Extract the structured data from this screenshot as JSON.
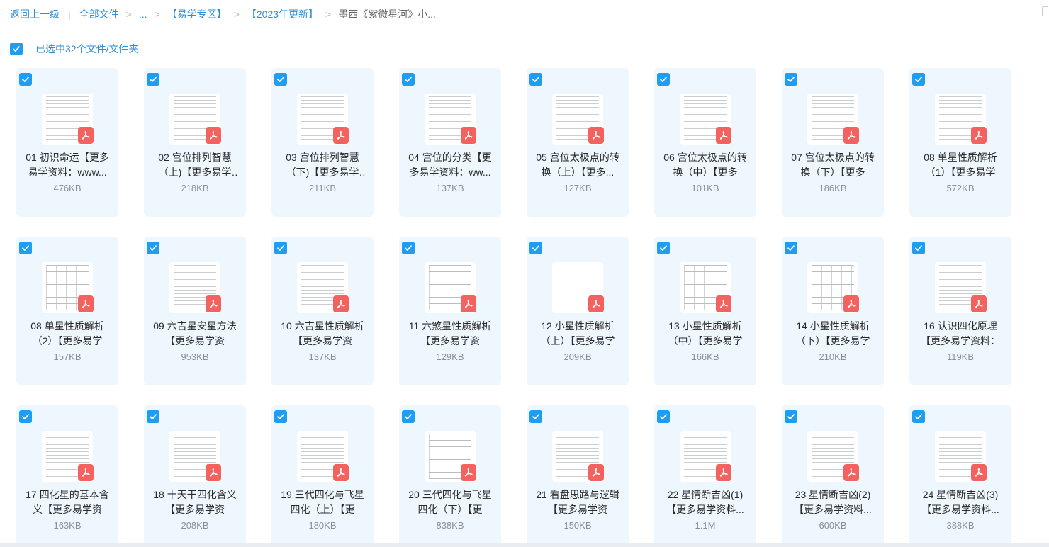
{
  "breadcrumb": {
    "back": "返回上一级",
    "all_files": "全部文件",
    "ellipsis": "...",
    "level1": "【易学专区】",
    "level2": "【2023年更新】",
    "current": "墨西《紫微星河》小..."
  },
  "selection": {
    "label": "已选中32个文件/文件夹"
  },
  "files": [
    {
      "name": "01 初识命运【更多易学资料：www...",
      "size": "476KB",
      "thumb": "lines"
    },
    {
      "name": "02 宫位排列智慧（上)【更多易学资...",
      "size": "218KB",
      "thumb": "lines"
    },
    {
      "name": "03 宫位排列智慧（下)【更多易学资...",
      "size": "211KB",
      "thumb": "lines"
    },
    {
      "name": "04 宫位的分类【更多易学资料：ww...",
      "size": "137KB",
      "thumb": "lines"
    },
    {
      "name": "05 宫位太极点的转换（上）【更多...",
      "size": "127KB",
      "thumb": "lines"
    },
    {
      "name": "06 宫位太极点的转换（中）【更多",
      "size": "101KB",
      "thumb": "lines"
    },
    {
      "name": "07 宫位太极点的转换（下）【更多",
      "size": "186KB",
      "thumb": "lines"
    },
    {
      "name": "08 单星性质解析（1）【更多易学",
      "size": "572KB",
      "thumb": "lines"
    },
    {
      "name": "08 单星性质解析（2）【更多易学",
      "size": "157KB",
      "thumb": "table"
    },
    {
      "name": "09 六吉星安星方法【更多易学资",
      "size": "953KB",
      "thumb": "lines"
    },
    {
      "name": "10 六吉星性质解析【更多易学资",
      "size": "137KB",
      "thumb": "lines"
    },
    {
      "name": "11 六煞星性质解析【更多易学资",
      "size": "129KB",
      "thumb": "table"
    },
    {
      "name": "12 小星性质解析（上）【更多易学",
      "size": "209KB",
      "thumb": "blank"
    },
    {
      "name": "13 小星性质解析（中）【更多易学",
      "size": "166KB",
      "thumb": "table"
    },
    {
      "name": "14 小星性质解析（下）【更多易学",
      "size": "210KB",
      "thumb": "table"
    },
    {
      "name": "16 认识四化原理【更多易学资料：",
      "size": "119KB",
      "thumb": "lines"
    },
    {
      "name": "17 四化星的基本含义【更多易学资",
      "size": "163KB",
      "thumb": "lines"
    },
    {
      "name": "18 十天干四化含义【更多易学资",
      "size": "208KB",
      "thumb": "lines"
    },
    {
      "name": "19 三代四化与飞星四化（上）【更",
      "size": "180KB",
      "thumb": "lines"
    },
    {
      "name": "20 三代四化与飞星四化（下）【更",
      "size": "838KB",
      "thumb": "table"
    },
    {
      "name": "21 看盘思路与逻辑【更多易学资",
      "size": "150KB",
      "thumb": "lines"
    },
    {
      "name": "22 星情断吉凶(1)【更多易学资料...",
      "size": "1.1M",
      "thumb": "lines"
    },
    {
      "name": "23 星情断吉凶(2)【更多易学资料...",
      "size": "600KB",
      "thumb": "lines"
    },
    {
      "name": "24 星情断吉凶(3)【更多易学资料...",
      "size": "388KB",
      "thumb": "lines"
    }
  ],
  "icons": {
    "checkbox": "checkmark-icon",
    "file_type": "pdf-icon"
  },
  "colors": {
    "accent": "#1e9ef3",
    "link": "#2c8ed6",
    "card_bg": "#eef7fe",
    "pdf_red": "#f4625f"
  }
}
